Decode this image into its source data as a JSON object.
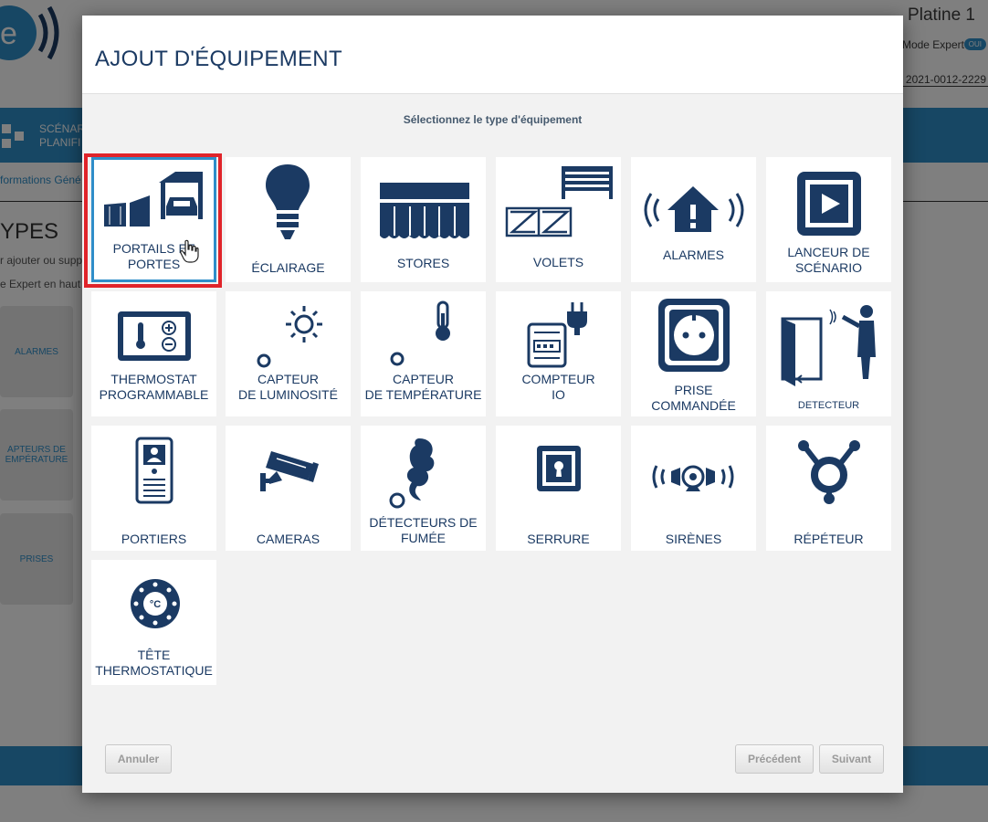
{
  "background": {
    "app_title": "Platine 1",
    "mode_label": "Mode Expert",
    "mode_badge": "OUI",
    "serial": ": 2021-0012-2229",
    "nav_text_line1": "SCÉNAR",
    "nav_text_line2": "PLANIFI",
    "info_tab": "formations Géné",
    "types_heading": "YPES",
    "help_line1": "r ajouter ou supp",
    "help_line2": "e Expert en haut",
    "cards": [
      "ALARMES",
      "APTEURS DE EMPÉRATURE",
      "PRISES"
    ]
  },
  "modal": {
    "title": "AJOUT D'ÉQUIPEMENT",
    "instruction": "Sélectionnez le type d'équipement",
    "tiles": [
      {
        "label": "PORTAILS ET\nPORTES",
        "icon": "gate-garage-icon"
      },
      {
        "label": "ÉCLAIRAGE",
        "icon": "light-bulb-icon"
      },
      {
        "label": "STORES",
        "icon": "awning-icon"
      },
      {
        "label": "VOLETS",
        "icon": "shutter-icon"
      },
      {
        "label": "ALARMES",
        "icon": "alarm-house-icon"
      },
      {
        "label": "LANCEUR DE\nSCÉNARIO",
        "icon": "play-icon"
      },
      {
        "label": "THERMOSTAT\nPROGRAMMABLE",
        "icon": "thermostat-icon"
      },
      {
        "label": "CAPTEUR\nDE LUMINOSITÉ",
        "icon": "sun-sensor-icon"
      },
      {
        "label": "CAPTEUR\nDE TEMPÉRATURE",
        "icon": "thermometer-sensor-icon"
      },
      {
        "label": "COMPTEUR\nIO",
        "icon": "meter-plug-icon"
      },
      {
        "label": "PRISE\nCOMMANDÉE",
        "icon": "socket-icon"
      },
      {
        "label": "DETECTEUR",
        "icon": "door-detector-icon"
      },
      {
        "label": "PORTIERS",
        "icon": "intercom-icon"
      },
      {
        "label": "CAMERAS",
        "icon": "camera-icon"
      },
      {
        "label": "DÉTECTEURS DE\nFUMÉE",
        "icon": "smoke-icon"
      },
      {
        "label": "SERRURE",
        "icon": "lock-icon"
      },
      {
        "label": "SIRÈNES",
        "icon": "siren-icon"
      },
      {
        "label": "RÉPÉTEUR",
        "icon": "repeater-icon"
      },
      {
        "label": "TÊTE\nTHERMOSTATIQUE",
        "icon": "thermostatic-head-icon"
      }
    ],
    "selected_tile": "PORTAILS ET PORTES",
    "buttons": {
      "cancel": "Annuler",
      "previous": "Précédent",
      "next": "Suivant"
    }
  },
  "colors": {
    "icon_navy": "#1b3a63",
    "accent_blue": "#2f8ec9",
    "highlight_red": "#e0242a"
  }
}
